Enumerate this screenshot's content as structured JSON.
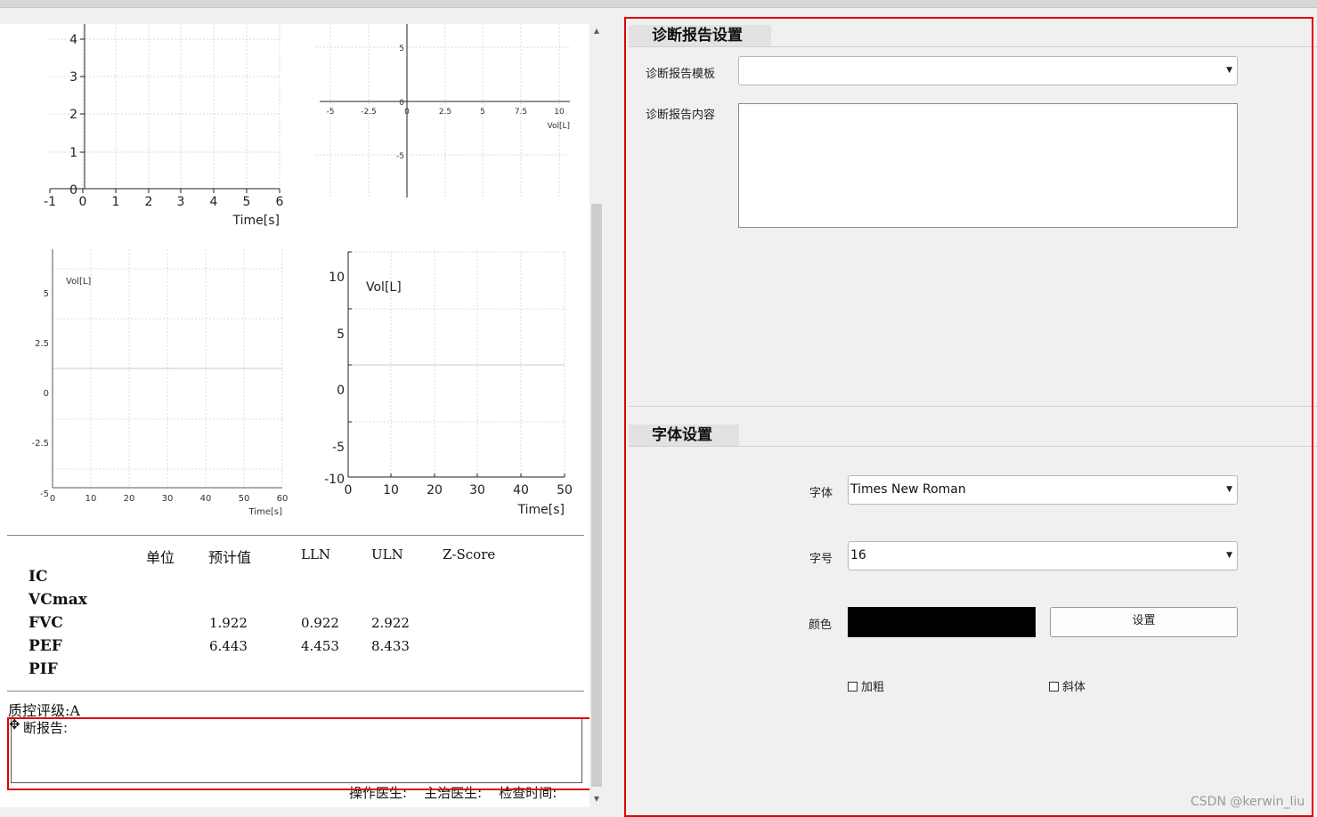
{
  "charts": {
    "chart1": {
      "yticks": [
        "4",
        "3",
        "2",
        "1",
        "0"
      ],
      "xticks": [
        "-1",
        "0",
        "1",
        "2",
        "3",
        "4",
        "5",
        "6"
      ],
      "xlabel": "Time[s]"
    },
    "chart2": {
      "xticks": [
        "-5",
        "-2.5",
        "0",
        "2.5",
        "5",
        "7.5",
        "10"
      ],
      "yticks": [
        "5",
        "0",
        "-5"
      ],
      "xlabel": "Vol[L]"
    },
    "chart3": {
      "ylabel": "Vol[L]",
      "yticks": [
        "5",
        "2.5",
        "0",
        "-2.5",
        "-5"
      ],
      "xticks": [
        "0",
        "10",
        "20",
        "30",
        "40",
        "50",
        "60"
      ],
      "xlabel": "Time[s]"
    },
    "chart4": {
      "ylabel": "Vol[L]",
      "yticks": [
        "10",
        "5",
        "0",
        "-5",
        "-10"
      ],
      "xticks": [
        "0",
        "10",
        "20",
        "30",
        "40",
        "50"
      ],
      "xlabel": "Time[s]"
    }
  },
  "chart_data": [
    {
      "type": "line",
      "xlabel": "Time[s]",
      "xlim": [
        -1,
        6
      ],
      "ylim": [
        0,
        4.4
      ],
      "series": []
    },
    {
      "type": "line",
      "xlabel": "Vol[L]",
      "xlim": [
        -5,
        10
      ],
      "ylim": [
        -5,
        5
      ],
      "series": []
    },
    {
      "type": "line",
      "ylabel": "Vol[L]",
      "xlabel": "Time[s]",
      "xlim": [
        0,
        60
      ],
      "ylim": [
        -5,
        5
      ],
      "series": []
    },
    {
      "type": "line",
      "ylabel": "Vol[L]",
      "xlabel": "Time[s]",
      "xlim": [
        0,
        50
      ],
      "ylim": [
        -10,
        10
      ],
      "series": []
    }
  ],
  "table": {
    "headers": [
      "单位",
      "预计值",
      "LLN",
      "ULN",
      "Z-Score"
    ],
    "rows": [
      {
        "name": "IC",
        "pred": "",
        "lln": "",
        "uln": ""
      },
      {
        "name": "VCmax",
        "pred": "",
        "lln": "",
        "uln": ""
      },
      {
        "name": "FVC",
        "pred": "1.922",
        "lln": "0.922",
        "uln": "2.922"
      },
      {
        "name": "PEF",
        "pred": "6.443",
        "lln": "4.453",
        "uln": "8.433"
      },
      {
        "name": "PIF",
        "pred": "",
        "lln": "",
        "uln": ""
      }
    ]
  },
  "report": {
    "quality": "质控评级:A",
    "diagnosis_label": "断报告:",
    "move_icon": "✥",
    "footer": "操作医生:    主治医生:    检查时间:"
  },
  "settings": {
    "report_group_title": "诊断报告设置",
    "template_label": "诊断报告模板",
    "template_value": "",
    "content_label": "诊断报告内容",
    "font_group_title": "字体设置",
    "font_label": "字体",
    "font_value": "Times New Roman",
    "size_label": "字号",
    "size_value": "16",
    "color_label": "颜色",
    "color_value": "#000000",
    "set_button": "设置",
    "bold_label": "加粗",
    "italic_label": "斜体"
  },
  "watermark": "CSDN @kerwin_liu",
  "colors": {
    "highlight": "#e00000",
    "grid": "#d8d8d8"
  }
}
